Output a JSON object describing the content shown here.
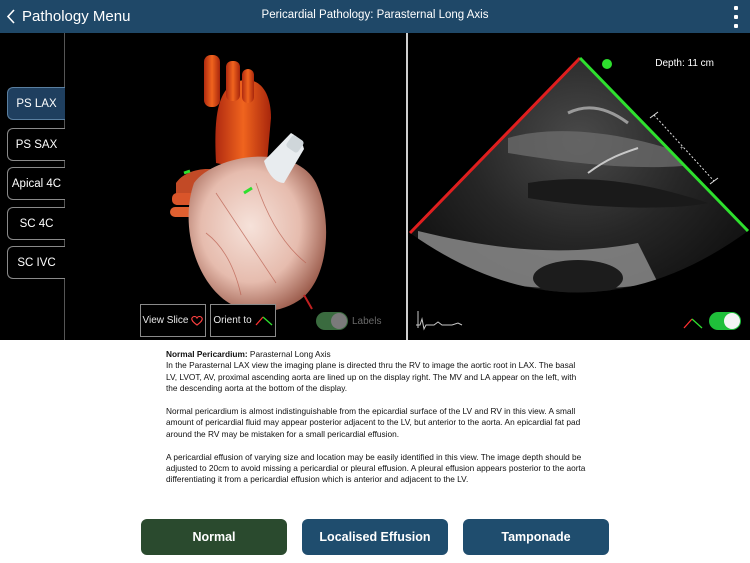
{
  "header": {
    "back_label": "Pathology Menu",
    "title": "Pericardial Pathology: Parasternal Long Axis",
    "menu_icon": "kebab-menu-icon"
  },
  "sidebar": {
    "items": [
      {
        "label": "PS LAX",
        "active": true
      },
      {
        "label": "PS SAX",
        "active": false
      },
      {
        "label": "Apical 4C",
        "active": false
      },
      {
        "label": "SC 4C",
        "active": false
      },
      {
        "label": "SC IVC",
        "active": false
      }
    ]
  },
  "model_controls": {
    "view_slice_label": "View Slice",
    "orient_to_label": "Orient to",
    "labels_label": "Labels",
    "labels_on": false
  },
  "echo": {
    "depth_label": "Depth: 11 cm",
    "sector_toggle_on": true
  },
  "description": {
    "heading_bold": "Normal Pericardium:",
    "heading_rest": " Parasternal Long Axis",
    "p1": "In the Parasternal LAX view the imaging plane is directed thru the RV to image the aortic root in LAX. The basal LV, LVOT, AV, proximal ascending aorta are lined up on the display right. The MV and LA appear on the left, with the descending aorta at the bottom of the display.",
    "p2": "Normal pericardium is almost indistinguishable from the epicardial surface of the LV and RV in this view. A small amount of pericardial fluid may appear posterior adjacent to the LV, but anterior to the aorta. An epicardial fat pad around the RV may be mistaken for a small pericardial effusion.",
    "p3": "A pericardial effusion of varying size and location may be easily identified in this view. The image depth should be adjusted to 20cm to avoid missing a pericardial or pleural effusion. A pleural effusion appears posterior to the aorta differentiating it from a pericardial effusion which is anterior and adjacent to the LV."
  },
  "pathology_buttons": [
    {
      "label": "Normal",
      "selected": true
    },
    {
      "label": "Localised Effusion",
      "selected": false
    },
    {
      "label": "Tamponade",
      "selected": false
    }
  ],
  "colors": {
    "header_bg": "#1f4868",
    "active_tab": "#1f3f5f",
    "selected_button": "#2a4a2e",
    "button": "#1f4d6e",
    "sector_red": "#e01e1e",
    "sector_green": "#2ee02e",
    "toggle_green": "#1fbf3a"
  }
}
